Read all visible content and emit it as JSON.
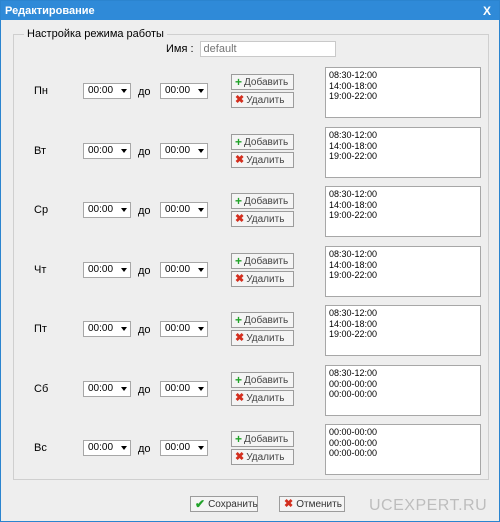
{
  "window": {
    "title": "Редактирование",
    "close_label": "X"
  },
  "fieldset": {
    "legend": "Настройка режима работы"
  },
  "name": {
    "label": "Имя :",
    "placeholder": "default"
  },
  "days": [
    {
      "label": "Пн",
      "from": "00:00",
      "do_label": "до",
      "to": "00:00",
      "add_label": "Добавить",
      "delete_label": "Удалить",
      "intervals": [
        "08:30-12:00",
        "14:00-18:00",
        "19:00-22:00"
      ]
    },
    {
      "label": "Вт",
      "from": "00:00",
      "do_label": "до",
      "to": "00:00",
      "add_label": "Добавить",
      "delete_label": "Удалить",
      "intervals": [
        "08:30-12:00",
        "14:00-18:00",
        "19:00-22:00"
      ]
    },
    {
      "label": "Ср",
      "from": "00:00",
      "do_label": "до",
      "to": "00:00",
      "add_label": "Добавить",
      "delete_label": "Удалить",
      "intervals": [
        "08:30-12:00",
        "14:00-18:00",
        "19:00-22:00"
      ]
    },
    {
      "label": "Чт",
      "from": "00:00",
      "do_label": "до",
      "to": "00:00",
      "add_label": "Добавить",
      "delete_label": "Удалить",
      "intervals": [
        "08:30-12:00",
        "14:00-18:00",
        "19:00-22:00"
      ]
    },
    {
      "label": "Пт",
      "from": "00:00",
      "do_label": "до",
      "to": "00:00",
      "add_label": "Добавить",
      "delete_label": "Удалить",
      "intervals": [
        "08:30-12:00",
        "14:00-18:00",
        "19:00-22:00"
      ]
    },
    {
      "label": "Сб",
      "from": "00:00",
      "do_label": "до",
      "to": "00:00",
      "add_label": "Добавить",
      "delete_label": "Удалить",
      "intervals": [
        "08:30-12:00",
        "00:00-00:00",
        "00:00-00:00"
      ]
    },
    {
      "label": "Вс",
      "from": "00:00",
      "do_label": "до",
      "to": "00:00",
      "add_label": "Добавить",
      "delete_label": "Удалить",
      "intervals": [
        "00:00-00:00",
        "00:00-00:00",
        "00:00-00:00"
      ]
    }
  ],
  "footer": {
    "save_label": "Сохранить",
    "cancel_label": "Отменить"
  },
  "watermark": "UCEXPERT.RU",
  "colors": {
    "titlebar": "#2f8ad8",
    "add_icon": "#22a32a",
    "delete_icon": "#d32f1f"
  },
  "icons": {
    "add": "plus-icon",
    "delete": "cross-icon",
    "save": "check-icon",
    "cancel": "cross-icon"
  }
}
